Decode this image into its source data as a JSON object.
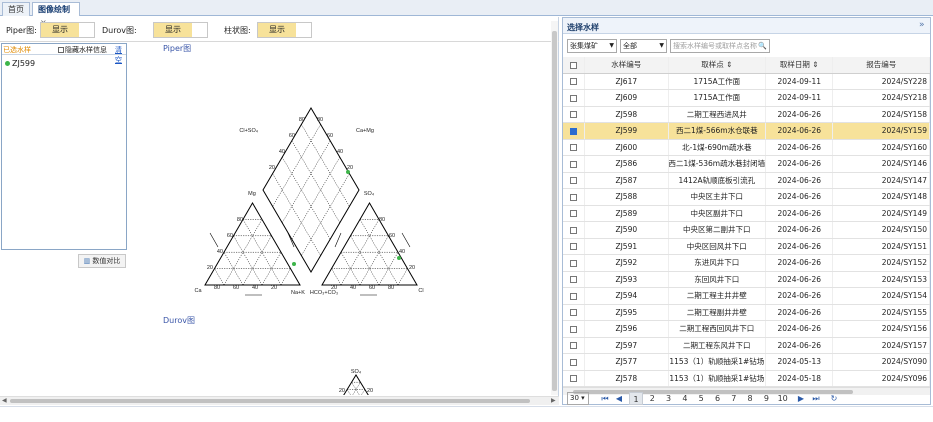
{
  "tabs": [
    {
      "label": "首页",
      "active": false
    },
    {
      "label": "图像绘制",
      "active": true,
      "close": "×"
    }
  ],
  "toolbar": {
    "piper_label": "Piper图:",
    "durov_label": "Durov图:",
    "bar_label": "柱状图:",
    "toggle_text": "显示"
  },
  "sample_panel": {
    "selected_label": "已选水样",
    "hide_label": "隐藏水样信息",
    "clear_label": "清空",
    "items": [
      {
        "id": "ZJ599",
        "color": "#3db54a"
      }
    ],
    "compare_button": "数值对比"
  },
  "piper": {
    "title": "Piper图",
    "labels": {
      "cl_so4": "Cl+SO₄",
      "ca_mg": "Ca+Mg",
      "mg": "Mg",
      "so4": "SO₄",
      "ca": "Ca",
      "na_k": "Na+K",
      "hco3": "HCO₃+CO₃",
      "cl": "Cl"
    },
    "ticks": [
      "20",
      "40",
      "60",
      "80"
    ]
  },
  "durov": {
    "title": "Durov图",
    "labels": {
      "so4": "SO₄"
    },
    "ticks": [
      "20",
      "40",
      "60"
    ]
  },
  "right_panel": {
    "title": "选择水样",
    "collapse_icon": "»",
    "filter_mine": "张集煤矿",
    "filter_all": "全部",
    "search_placeholder": "搜索水样编号或取样点名称",
    "columns": [
      "水样编号",
      "取样点",
      "取样日期",
      "报告编号"
    ],
    "rows": [
      {
        "id": "ZJ617",
        "point": "1715A工作面",
        "date": "2024-09-11",
        "report": "2024/SY228",
        "checked": false
      },
      {
        "id": "ZJ609",
        "point": "1715A工作面",
        "date": "2024-09-11",
        "report": "2024/SY218",
        "checked": false
      },
      {
        "id": "ZJ598",
        "point": "二期工程西进风井",
        "date": "2024-06-26",
        "report": "2024/SY158",
        "checked": false
      },
      {
        "id": "ZJ599",
        "point": "西二1煤-566m水仓联巷",
        "date": "2024-06-26",
        "report": "2024/SY159",
        "checked": true
      },
      {
        "id": "ZJ600",
        "point": "北-1煤-690m疏水巷",
        "date": "2024-06-26",
        "report": "2024/SY160",
        "checked": false
      },
      {
        "id": "ZJ586",
        "point": "西二1煤-536m疏水巷封闭墙",
        "date": "2024-06-26",
        "report": "2024/SY146",
        "checked": false
      },
      {
        "id": "ZJ587",
        "point": "1412A轨顺底板引流孔",
        "date": "2024-06-26",
        "report": "2024/SY147",
        "checked": false
      },
      {
        "id": "ZJ588",
        "point": "中央区主井下口",
        "date": "2024-06-26",
        "report": "2024/SY148",
        "checked": false
      },
      {
        "id": "ZJ589",
        "point": "中央区副井下口",
        "date": "2024-06-26",
        "report": "2024/SY149",
        "checked": false
      },
      {
        "id": "ZJ590",
        "point": "中央区第二副井下口",
        "date": "2024-06-26",
        "report": "2024/SY150",
        "checked": false
      },
      {
        "id": "ZJ591",
        "point": "中央区回风井下口",
        "date": "2024-06-26",
        "report": "2024/SY151",
        "checked": false
      },
      {
        "id": "ZJ592",
        "point": "东进风井下口",
        "date": "2024-06-26",
        "report": "2024/SY152",
        "checked": false
      },
      {
        "id": "ZJ593",
        "point": "东回风井下口",
        "date": "2024-06-26",
        "report": "2024/SY153",
        "checked": false
      },
      {
        "id": "ZJ594",
        "point": "二期工程主井井壁",
        "date": "2024-06-26",
        "report": "2024/SY154",
        "checked": false
      },
      {
        "id": "ZJ595",
        "point": "二期工程副井井壁",
        "date": "2024-06-26",
        "report": "2024/SY155",
        "checked": false
      },
      {
        "id": "ZJ596",
        "point": "二期工程西回风井下口",
        "date": "2024-06-26",
        "report": "2024/SY156",
        "checked": false
      },
      {
        "id": "ZJ597",
        "point": "二期工程东风井下口",
        "date": "2024-06-26",
        "report": "2024/SY157",
        "checked": false
      },
      {
        "id": "ZJ577",
        "point": "1153（1）轨顺抽采1#钻场",
        "date": "2024-05-13",
        "report": "2024/SY090",
        "checked": false
      },
      {
        "id": "ZJ578",
        "point": "1153（1）轨顺抽采1#钻场",
        "date": "2024-05-18",
        "report": "2024/SY096",
        "checked": false
      }
    ],
    "pager": {
      "page_size": "30",
      "pages": [
        "1",
        "2",
        "3",
        "4",
        "5",
        "6",
        "7",
        "8",
        "9",
        "10"
      ],
      "current": "1",
      "first": "⏮",
      "prev": "◀",
      "next": "▶",
      "last": "⏭",
      "refresh": "↻"
    }
  }
}
